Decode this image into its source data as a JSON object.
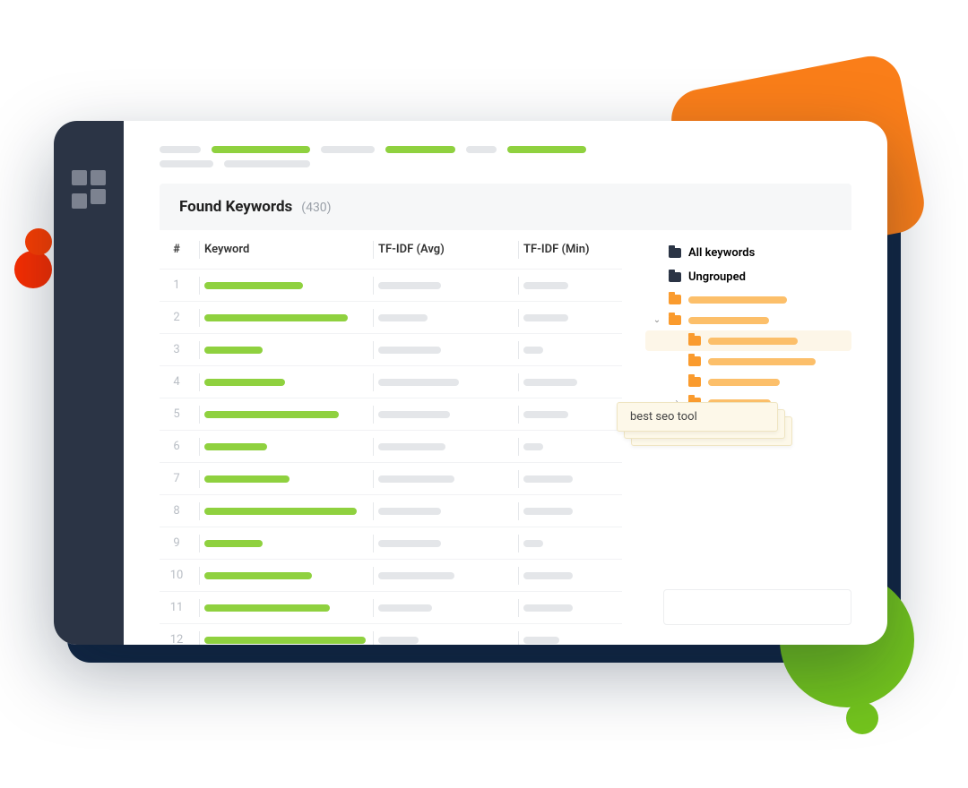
{
  "breadcrumb": {
    "pills": [
      {
        "color": "gray",
        "w": 46
      },
      {
        "color": "green",
        "w": 110
      },
      {
        "color": "gray",
        "w": 60
      },
      {
        "color": "green",
        "w": 78
      },
      {
        "color": "gray",
        "w": 34
      },
      {
        "color": "green",
        "w": 88
      }
    ],
    "pills_row2": [
      {
        "color": "gray",
        "w": 60
      },
      {
        "color": "gray",
        "w": 96
      }
    ]
  },
  "panel": {
    "title": "Found Keywords",
    "count": "(430)"
  },
  "table": {
    "headers": {
      "num": "#",
      "keyword": "Keyword",
      "avg": "TF-IDF (Avg)",
      "min": "TF-IDF (Min)"
    },
    "rows": [
      {
        "n": "1",
        "kw": 110,
        "avg": 70,
        "min": 50
      },
      {
        "n": "2",
        "kw": 160,
        "avg": 55,
        "min": 50
      },
      {
        "n": "3",
        "kw": 65,
        "avg": 70,
        "min": 22
      },
      {
        "n": "4",
        "kw": 90,
        "avg": 90,
        "min": 60
      },
      {
        "n": "5",
        "kw": 150,
        "avg": 80,
        "min": 50
      },
      {
        "n": "6",
        "kw": 70,
        "avg": 75,
        "min": 22
      },
      {
        "n": "7",
        "kw": 95,
        "avg": 85,
        "min": 55
      },
      {
        "n": "8",
        "kw": 170,
        "avg": 70,
        "min": 55
      },
      {
        "n": "9",
        "kw": 65,
        "avg": 70,
        "min": 22
      },
      {
        "n": "10",
        "kw": 120,
        "avg": 85,
        "min": 55
      },
      {
        "n": "11",
        "kw": 140,
        "avg": 60,
        "min": 55
      },
      {
        "n": "12",
        "kw": 180,
        "avg": 45,
        "min": 40
      }
    ]
  },
  "tree": {
    "all": "All keywords",
    "ungrouped": "Ungrouped",
    "items": [
      {
        "indent": 0,
        "chev": "",
        "w": 110
      },
      {
        "indent": 0,
        "chev": "v",
        "w": 90
      },
      {
        "indent": 1,
        "chev": "",
        "w": 100,
        "hl": true
      },
      {
        "indent": 1,
        "chev": "",
        "w": 120
      },
      {
        "indent": 1,
        "chev": "",
        "w": 80
      },
      {
        "indent": 1,
        "chev": ">",
        "w": 70
      },
      {
        "indent": 0,
        "chev": "",
        "w": 90
      }
    ]
  },
  "tooltip": {
    "text": "best seo tool"
  }
}
